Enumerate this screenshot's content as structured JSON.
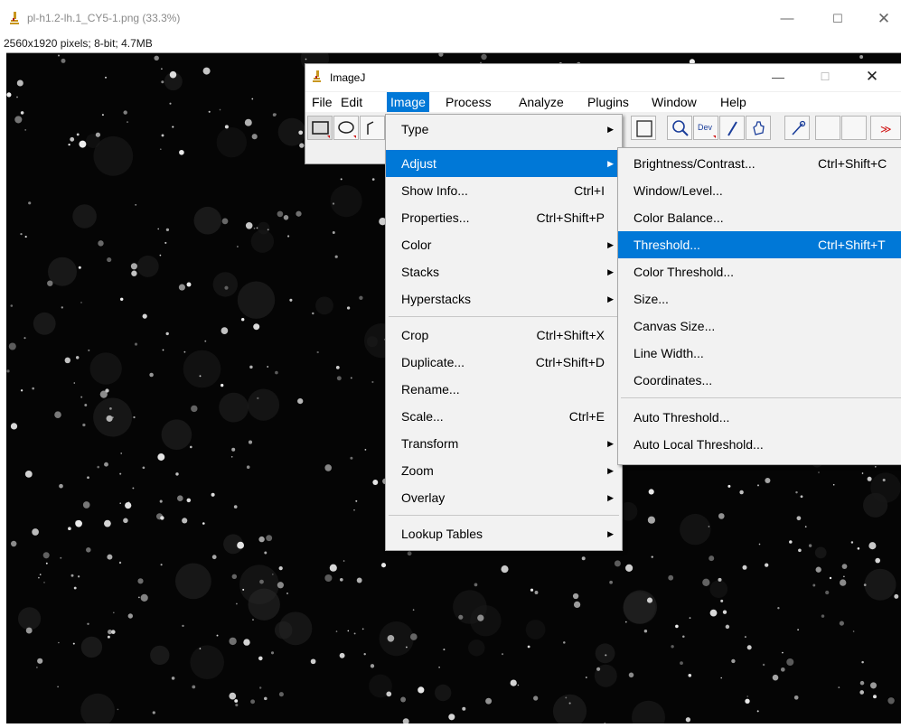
{
  "image_window": {
    "title": "pl-h1.2-lh.1_CY5-1.png (33.3%)",
    "subtitle": "2560x1920 pixels; 8-bit; 4.7MB",
    "minimize": "—",
    "maximize": "☐",
    "close": "✕",
    "icon": "imagej-microscope-icon"
  },
  "imagej_window": {
    "title": "ImageJ",
    "minimize": "—",
    "maximize": "☐",
    "close": "✕",
    "menubar": {
      "file": "File",
      "edit": "Edit",
      "image": "Image",
      "process": "Process",
      "analyze": "Analyze",
      "plugins": "Plugins",
      "window": "Window",
      "help": "Help"
    },
    "toolbar": {
      "tools": [
        "rectangle-selection-icon",
        "oval-selection-icon",
        "polygon-selection-icon",
        "text-tool-icon",
        "magnifier-icon",
        "developer-menu-icon",
        "pencil-icon",
        "hand-icon",
        "color-picker-icon",
        "blank-tool",
        "more-tools-icon"
      ],
      "dev_label": "Dev",
      "more_label": "≫"
    }
  },
  "image_menu": {
    "items": [
      {
        "label": "Type",
        "shortcut": "",
        "submenu": true
      },
      {
        "label": "Adjust",
        "shortcut": "",
        "submenu": true
      },
      {
        "label": "Show Info...",
        "shortcut": "Ctrl+I",
        "submenu": false
      },
      {
        "label": "Properties...",
        "shortcut": "Ctrl+Shift+P",
        "submenu": false
      },
      {
        "label": "Color",
        "shortcut": "",
        "submenu": true
      },
      {
        "label": "Stacks",
        "shortcut": "",
        "submenu": true
      },
      {
        "label": "Hyperstacks",
        "shortcut": "",
        "submenu": true
      },
      {
        "label": "Crop",
        "shortcut": "Ctrl+Shift+X",
        "submenu": false
      },
      {
        "label": "Duplicate...",
        "shortcut": "Ctrl+Shift+D",
        "submenu": false
      },
      {
        "label": "Rename...",
        "shortcut": "",
        "submenu": false
      },
      {
        "label": "Scale...",
        "shortcut": "Ctrl+E",
        "submenu": false
      },
      {
        "label": "Transform",
        "shortcut": "",
        "submenu": true
      },
      {
        "label": "Zoom",
        "shortcut": "",
        "submenu": true
      },
      {
        "label": "Overlay",
        "shortcut": "",
        "submenu": true
      },
      {
        "label": "Lookup Tables",
        "shortcut": "",
        "submenu": true
      }
    ],
    "arrow": "▶"
  },
  "adjust_menu": {
    "items": [
      {
        "label": "Brightness/Contrast...",
        "shortcut": "Ctrl+Shift+C"
      },
      {
        "label": "Window/Level...",
        "shortcut": ""
      },
      {
        "label": "Color Balance...",
        "shortcut": ""
      },
      {
        "label": "Threshold...",
        "shortcut": "Ctrl+Shift+T"
      },
      {
        "label": "Color Threshold...",
        "shortcut": ""
      },
      {
        "label": "Size...",
        "shortcut": ""
      },
      {
        "label": "Canvas Size...",
        "shortcut": ""
      },
      {
        "label": "Line Width...",
        "shortcut": ""
      },
      {
        "label": "Coordinates...",
        "shortcut": ""
      },
      {
        "label": "Auto Threshold...",
        "shortcut": ""
      },
      {
        "label": "Auto Local Threshold...",
        "shortcut": ""
      }
    ]
  },
  "colors": {
    "highlight": "#0078d7",
    "menu_bg": "#f2f2f2",
    "image_bg": "#050505",
    "toolbar_accent": "#d01010"
  }
}
